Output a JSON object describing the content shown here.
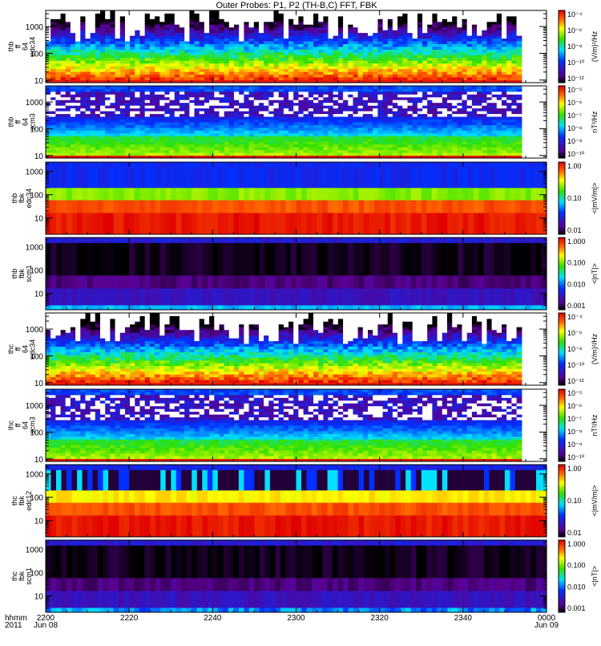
{
  "chart_data": {
    "type": "heatmap",
    "title": "Outer Probes: P1, P2 (TH-B,C) FFT, FBK",
    "x_axis": {
      "ticks": [
        "2200",
        "2220",
        "2240",
        "2300",
        "2320",
        "2340",
        "0000"
      ],
      "tick_minutes": [
        0,
        20,
        40,
        60,
        80,
        100,
        120
      ],
      "range_minutes": [
        0,
        120
      ],
      "label_top": "hhmm",
      "label_bottom": "2011",
      "date_start": "Jun 08",
      "date_end": "Jun 09"
    },
    "panels": [
      {
        "label": [
          "thb",
          "ff",
          "64",
          "edc34"
        ],
        "kind": "ff-e",
        "yrange": [
          8,
          4000
        ],
        "yticks": [
          "10",
          "100",
          "1000"
        ],
        "data_end_minutes": 114,
        "colorbar": {
          "unit": "(V/m)²/Hz",
          "ticks": [
            "10⁻⁴",
            "10⁻⁶",
            "10⁻⁸",
            "10⁻¹⁰",
            "10⁻¹²"
          ]
        }
      },
      {
        "label": [
          "thb",
          "ff",
          "64",
          "scm3"
        ],
        "kind": "ff-b",
        "yrange": [
          8,
          4000
        ],
        "yticks": [
          "10",
          "100",
          "1000"
        ],
        "data_end_minutes": 114,
        "colorbar": {
          "unit": "nT²/Hz",
          "ticks": [
            "10⁻⁵",
            "10⁻⁶",
            "10⁻⁷",
            "10⁻⁸",
            "10⁻⁹",
            "10⁻¹⁰"
          ]
        }
      },
      {
        "label": [
          "thb",
          "fbk",
          "edc34"
        ],
        "kind": "fbk",
        "yrange": [
          2,
          2500
        ],
        "yticks": [
          "10",
          "100",
          "1000"
        ],
        "data_end_minutes": 120,
        "bands": [
          [
            2,
            17,
            0.97
          ],
          [
            17,
            60,
            0.9
          ],
          [
            60,
            200,
            0.66
          ],
          [
            200,
            1500,
            0.27
          ],
          [
            1500,
            2500,
            0.27
          ]
        ],
        "colorbar": {
          "unit": "<|mV/m|>",
          "ticks": [
            "1.00",
            "0.10",
            "0.01"
          ]
        }
      },
      {
        "label": [
          "thb",
          "fbk",
          "scm1"
        ],
        "kind": "fbk",
        "yrange": [
          2,
          2500
        ],
        "yticks": [
          "10",
          "100",
          "1000"
        ],
        "data_end_minutes": 120,
        "bands": [
          [
            2,
            3.2,
            0.42
          ],
          [
            3.2,
            17,
            0.18
          ],
          [
            17,
            60,
            0.09
          ],
          [
            60,
            1500,
            0.02
          ],
          [
            1500,
            2500,
            0.22
          ]
        ],
        "colorbar": {
          "unit": "<|nT|>",
          "ticks": [
            "1.000",
            "0.100",
            "0.010",
            "0.001"
          ]
        }
      },
      {
        "label": [
          "thc",
          "ff",
          "64",
          "edc34"
        ],
        "kind": "ff-e",
        "yrange": [
          8,
          4000
        ],
        "yticks": [
          "10",
          "100",
          "1000"
        ],
        "data_end_minutes": 114,
        "colorbar": {
          "unit": "(V/m)²/Hz",
          "ticks": [
            "10⁻⁴",
            "10⁻⁶",
            "10⁻⁸",
            "10⁻¹⁰",
            "10⁻¹²"
          ]
        }
      },
      {
        "label": [
          "thc",
          "ff",
          "64",
          "scm3"
        ],
        "kind": "ff-b",
        "yrange": [
          8,
          4000
        ],
        "yticks": [
          "10",
          "100",
          "1000"
        ],
        "data_end_minutes": 114,
        "colorbar": {
          "unit": "nT²/Hz",
          "ticks": [
            "10⁻⁵",
            "10⁻⁶",
            "10⁻⁷",
            "10⁻⁸",
            "10⁻⁹",
            "10⁻¹⁰"
          ]
        }
      },
      {
        "label": [
          "thc",
          "fbk",
          "edc12"
        ],
        "kind": "fbk",
        "yrange": [
          2,
          2500
        ],
        "yticks": [
          "10",
          "100",
          "1000"
        ],
        "data_end_minutes": 120,
        "bands": [
          [
            2,
            17,
            0.97
          ],
          [
            17,
            60,
            0.9
          ],
          [
            60,
            200,
            0.76
          ],
          [
            200,
            1500,
            0.1
          ],
          [
            1500,
            2500,
            0.25
          ]
        ],
        "colorbar": {
          "unit": "<|mV/m|>",
          "ticks": [
            "1.00",
            "0.10",
            "0.01"
          ]
        }
      },
      {
        "label": [
          "thc",
          "fbk",
          "scm1"
        ],
        "kind": "fbk",
        "yrange": [
          2,
          2500
        ],
        "yticks": [
          "10",
          "100",
          "1000"
        ],
        "data_end_minutes": 120,
        "bands": [
          [
            2,
            3.2,
            0.38
          ],
          [
            3.2,
            17,
            0.18
          ],
          [
            17,
            60,
            0.09
          ],
          [
            60,
            1500,
            0.02
          ],
          [
            1500,
            2500,
            0.22
          ]
        ],
        "colorbar": {
          "unit": "<|nT|>",
          "ticks": [
            "1.000",
            "0.100",
            "0.010",
            "0.001"
          ]
        }
      }
    ]
  }
}
